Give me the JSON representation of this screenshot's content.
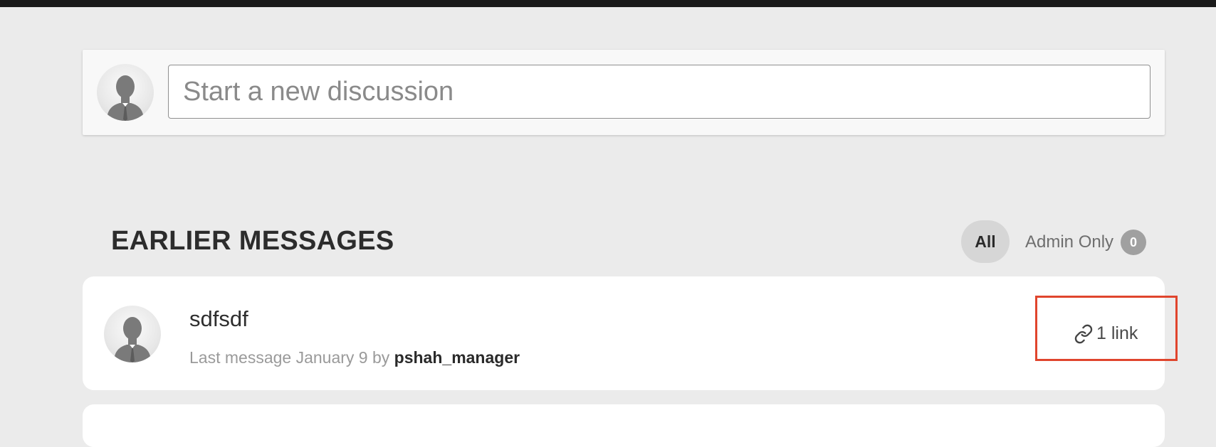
{
  "composer": {
    "placeholder": "Start a new discussion",
    "avatar_icon": "default-user-silhouette-icon"
  },
  "messages_section": {
    "title": "EARLIER MESSAGES",
    "filters": {
      "all_label": "All",
      "admin_only_label": "Admin Only",
      "admin_only_count": "0",
      "selected": "All"
    }
  },
  "messages": [
    {
      "title": "sdfsdf",
      "meta_prefix": "Last message January 9 by",
      "author": "pshah_manager",
      "link_count_label": "1 link",
      "link_icon": "link-chain-icon",
      "avatar_icon": "default-user-silhouette-icon"
    }
  ],
  "colors": {
    "background": "#ebebeb",
    "top_bar": "#1a1a1a",
    "card": "#ffffff",
    "highlight": "#e0452d",
    "badge": "#a0a0a0",
    "filter_selected": "#d6d6d6"
  }
}
